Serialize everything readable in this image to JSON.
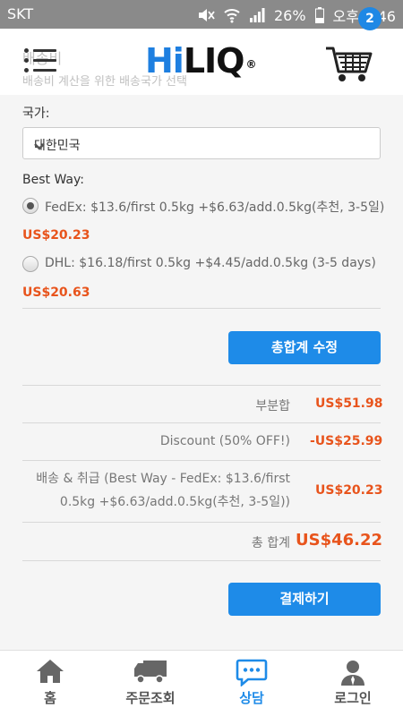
{
  "status_bar": {
    "carrier": "SKT",
    "battery": "26%",
    "time": "오후 2:46"
  },
  "header": {
    "logo_hi": "Hi",
    "logo_liq": "LIQ",
    "logo_reg": "®",
    "cart_count": "2",
    "ghost_title": "배송비",
    "ghost_sub": "배송비 계산을 위한 배송국가 선택"
  },
  "shipping": {
    "country_label": "국가:",
    "country_value": "대한민국",
    "method_label": "Best Way:",
    "options": [
      {
        "text": "FedEx: $13.6/first 0.5kg +$6.63/add.0.5kg(추천, 3-5일)",
        "price": "US$20.23",
        "selected": true
      },
      {
        "text": "DHL: $16.18/first 0.5kg +$4.45/add.0.5kg (3-5 days)",
        "price": "US$20.63",
        "selected": false
      }
    ],
    "update_button": "총합계 수정"
  },
  "totals": {
    "subtotal_label": "부분합",
    "subtotal_value": "US$51.98",
    "discount_label": "Discount (50% OFF!)",
    "discount_value": "-US$25.99",
    "shipping_label_line1": "배송 & 취급 (Best Way - FedEx: $13.6/first",
    "shipping_label_line2": "0.5kg +$6.63/add.0.5kg(추천, 3-5일))",
    "shipping_value": "US$20.23",
    "total_label": "총 합계",
    "total_value": "US$46.22"
  },
  "checkout_button": "결제하기",
  "bottom_nav": [
    {
      "label": "홈",
      "icon": "home-icon",
      "active": false
    },
    {
      "label": "주문조회",
      "icon": "truck-icon",
      "active": false
    },
    {
      "label": "상담",
      "icon": "chat-icon",
      "active": true
    },
    {
      "label": "로그인",
      "icon": "user-icon",
      "active": false
    }
  ],
  "colors": {
    "accent": "#1e8be8",
    "price": "#e8541c"
  }
}
